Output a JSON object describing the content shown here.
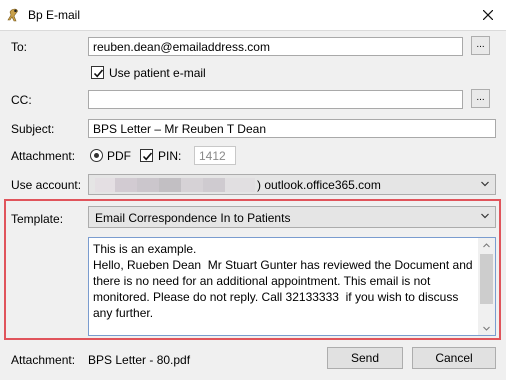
{
  "window": {
    "title": "Bp E-mail"
  },
  "labels": {
    "to": "To:",
    "cc": "CC:",
    "subject": "Subject:",
    "attachment": "Attachment:",
    "use_account": "Use account:",
    "template": "Template:",
    "attachment_bottom": "Attachment:"
  },
  "to": {
    "value": "reuben.dean@emailaddress.com",
    "browse_label": "..."
  },
  "use_patient_email": {
    "label": "Use patient e-mail",
    "checked": true
  },
  "cc": {
    "value": "",
    "browse_label": "..."
  },
  "subject": {
    "value": "BPS Letter – Mr Reuben T Dean"
  },
  "attachment_options": {
    "pdf_label": "PDF",
    "pdf_selected": true,
    "pin_label": "PIN:",
    "pin_checked": true,
    "pin_value": "1412"
  },
  "account": {
    "value_suffix": ") outlook.office365.com"
  },
  "template": {
    "selected": "Email Correspondence In to Patients"
  },
  "body_text": "This is an example.\nHello, Rueben Dean  Mr Stuart Gunter has reviewed the Document and there is no need for an additional appointment. This email is not monitored. Please do not reply. Call 32133333  if you wish to discuss any further.",
  "attachment_file": "BPS Letter - 80.pdf",
  "buttons": {
    "send": "Send",
    "cancel": "Cancel"
  },
  "colors": {
    "highlight_border": "#e0545b",
    "textarea_border": "#7a9ccf",
    "dialog_background": "#f0f0f0"
  },
  "icons": {
    "app": "bp-app-icon",
    "close": "close-icon",
    "checkbox": "checkmark-icon",
    "dropdown": "chevron-down-icon"
  }
}
